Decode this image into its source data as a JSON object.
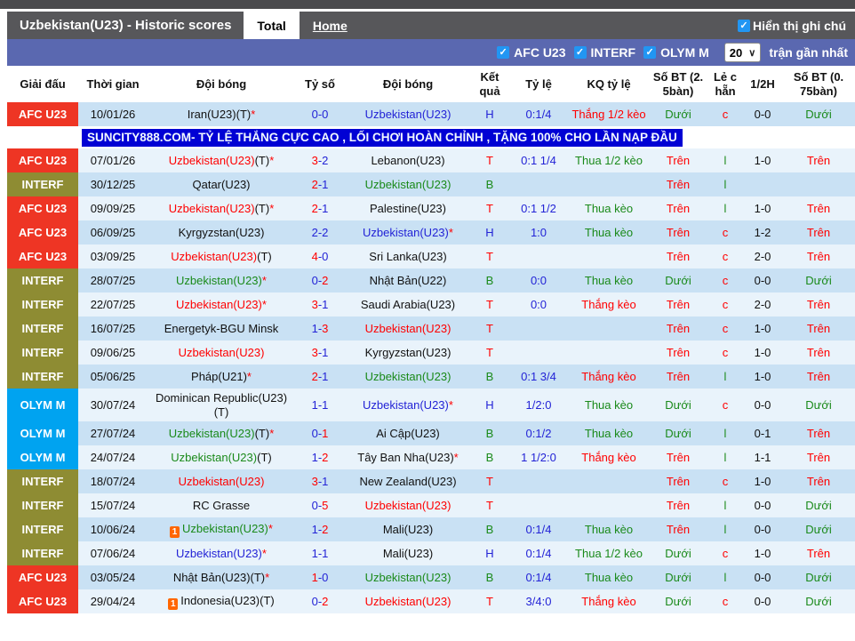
{
  "header": {
    "title": "Uzbekistan(U23) - Historic scores",
    "tabs": [
      {
        "label": "Total",
        "active": true
      },
      {
        "label": "Home",
        "active": false
      }
    ],
    "note_checkbox": {
      "label": "Hiển thị ghi chú",
      "checked": true
    }
  },
  "filterbar": {
    "filters": [
      {
        "label": "AFC U23",
        "checked": true
      },
      {
        "label": "INTERF",
        "checked": true
      },
      {
        "label": "OLYM M",
        "checked": true
      }
    ],
    "select_value": "20",
    "suffix": "trận gần nhất"
  },
  "colors": {
    "afc_badge": "#ee3524",
    "interf_badge": "#8e8c33",
    "olym_badge": "#00a3f0",
    "banner_bg": "#0101d4",
    "filter_bar": "#5a68b0",
    "title_bar": "#57575a",
    "row_odd": "#c9e1f4",
    "row_even": "#e9f3fb",
    "win_red": "#f00",
    "lose_green": "#1a8a1a",
    "draw_blue": "#2323d6"
  },
  "table": {
    "columns": [
      {
        "id": "league",
        "label": "Giải đấu"
      },
      {
        "id": "date",
        "label": "Thời gian"
      },
      {
        "id": "home",
        "label": "Đội bóng"
      },
      {
        "id": "score",
        "label": "Tỷ số"
      },
      {
        "id": "away",
        "label": "Đội bóng"
      },
      {
        "id": "result",
        "label": "Kết\nquả"
      },
      {
        "id": "odds",
        "label": "Tỷ lệ"
      },
      {
        "id": "odds_result",
        "label": "KQ tỷ lệ"
      },
      {
        "id": "goals25",
        "label": "Số BT (2.\n5bàn)"
      },
      {
        "id": "odd_even",
        "label": "Lẻ c\nhẵn"
      },
      {
        "id": "halftime",
        "label": "1/2H"
      },
      {
        "id": "goals075",
        "label": "Số BT (0.\n75bàn)"
      }
    ],
    "rows": [
      {
        "type": "match",
        "league": "AFC U23",
        "lt": "afc",
        "date": "10/01/26",
        "home": [
          {
            "t": "Iran(U23)(T)",
            "c": "black"
          },
          {
            "t": "*",
            "c": "red"
          }
        ],
        "sh": "0",
        "sa": "0",
        "shc": "blue",
        "sac": "blue",
        "away": [
          {
            "t": "Uzbekistan(U23)",
            "c": "blue"
          }
        ],
        "res": {
          "t": "H",
          "c": "blue"
        },
        "odds": "0:1/4",
        "kq": {
          "t": "Thắng 1/2 kèo",
          "c": "red"
        },
        "g25": {
          "t": "Dưới",
          "c": "green"
        },
        "oe": {
          "t": "c",
          "c": "red"
        },
        "ht": "0-0",
        "g075": {
          "t": "Dưới",
          "c": "green"
        }
      },
      {
        "type": "banner",
        "text": "SUNCITY888.COM- TỶ LỆ THẮNG CỰC CAO , LỐI CHƠI HOÀN CHỈNH , TẶNG 100% CHO LẦN NẠP ĐẦU"
      },
      {
        "type": "match",
        "league": "AFC U23",
        "lt": "afc",
        "date": "07/01/26",
        "home": [
          {
            "t": "Uzbekistan(U23)",
            "c": "red"
          },
          {
            "t": "(T)",
            "c": "black"
          },
          {
            "t": "*",
            "c": "red"
          }
        ],
        "sh": "3",
        "sa": "2",
        "shc": "red",
        "sac": "blue",
        "away": [
          {
            "t": "Lebanon(U23)",
            "c": "black"
          }
        ],
        "res": {
          "t": "T",
          "c": "red"
        },
        "odds": "0:1 1/4",
        "kq": {
          "t": "Thua 1/2 kèo",
          "c": "green"
        },
        "g25": {
          "t": "Trên",
          "c": "red"
        },
        "oe": {
          "t": "l",
          "c": "green"
        },
        "ht": "1-0",
        "g075": {
          "t": "Trên",
          "c": "red"
        }
      },
      {
        "type": "match",
        "league": "INTERF",
        "lt": "interf",
        "date": "30/12/25",
        "home": [
          {
            "t": "Qatar(U23)",
            "c": "black"
          }
        ],
        "sh": "2",
        "sa": "1",
        "shc": "red",
        "sac": "blue",
        "away": [
          {
            "t": "Uzbekistan(U23)",
            "c": "green"
          }
        ],
        "res": {
          "t": "B",
          "c": "green"
        },
        "odds": "",
        "kq": null,
        "g25": {
          "t": "Trên",
          "c": "red"
        },
        "oe": {
          "t": "l",
          "c": "green"
        },
        "ht": "",
        "g075": null
      },
      {
        "type": "match",
        "league": "AFC U23",
        "lt": "afc",
        "date": "09/09/25",
        "home": [
          {
            "t": "Uzbekistan(U23)",
            "c": "red"
          },
          {
            "t": "(T)",
            "c": "black"
          },
          {
            "t": "*",
            "c": "red"
          }
        ],
        "sh": "2",
        "sa": "1",
        "shc": "red",
        "sac": "blue",
        "away": [
          {
            "t": "Palestine(U23)",
            "c": "black"
          }
        ],
        "res": {
          "t": "T",
          "c": "red"
        },
        "odds": "0:1 1/2",
        "kq": {
          "t": "Thua kèo",
          "c": "green"
        },
        "g25": {
          "t": "Trên",
          "c": "red"
        },
        "oe": {
          "t": "l",
          "c": "green"
        },
        "ht": "1-0",
        "g075": {
          "t": "Trên",
          "c": "red"
        }
      },
      {
        "type": "match",
        "league": "AFC U23",
        "lt": "afc",
        "date": "06/09/25",
        "home": [
          {
            "t": "Kyrgyzstan(U23)",
            "c": "black"
          }
        ],
        "sh": "2",
        "sa": "2",
        "shc": "blue",
        "sac": "blue",
        "away": [
          {
            "t": "Uzbekistan(U23)",
            "c": "blue"
          },
          {
            "t": "*",
            "c": "red"
          }
        ],
        "res": {
          "t": "H",
          "c": "blue"
        },
        "odds": "1:0",
        "kq": {
          "t": "Thua kèo",
          "c": "green"
        },
        "g25": {
          "t": "Trên",
          "c": "red"
        },
        "oe": {
          "t": "c",
          "c": "red"
        },
        "ht": "1-2",
        "g075": {
          "t": "Trên",
          "c": "red"
        }
      },
      {
        "type": "match",
        "league": "AFC U23",
        "lt": "afc",
        "date": "03/09/25",
        "home": [
          {
            "t": "Uzbekistan(U23)",
            "c": "red"
          },
          {
            "t": "(T)",
            "c": "black"
          }
        ],
        "sh": "4",
        "sa": "0",
        "shc": "red",
        "sac": "blue",
        "away": [
          {
            "t": "Sri Lanka(U23)",
            "c": "black"
          }
        ],
        "res": {
          "t": "T",
          "c": "red"
        },
        "odds": "",
        "kq": null,
        "g25": {
          "t": "Trên",
          "c": "red"
        },
        "oe": {
          "t": "c",
          "c": "red"
        },
        "ht": "2-0",
        "g075": {
          "t": "Trên",
          "c": "red"
        }
      },
      {
        "type": "match",
        "league": "INTERF",
        "lt": "interf",
        "date": "28/07/25",
        "home": [
          {
            "t": "Uzbekistan(U23)",
            "c": "green"
          },
          {
            "t": "*",
            "c": "red"
          }
        ],
        "sh": "0",
        "sa": "2",
        "shc": "blue",
        "sac": "red",
        "away": [
          {
            "t": "Nhật Bản(U22)",
            "c": "black"
          }
        ],
        "res": {
          "t": "B",
          "c": "green"
        },
        "odds": "0:0",
        "kq": {
          "t": "Thua kèo",
          "c": "green"
        },
        "g25": {
          "t": "Dưới",
          "c": "green"
        },
        "oe": {
          "t": "c",
          "c": "red"
        },
        "ht": "0-0",
        "g075": {
          "t": "Dưới",
          "c": "green"
        }
      },
      {
        "type": "match",
        "league": "INTERF",
        "lt": "interf",
        "date": "22/07/25",
        "home": [
          {
            "t": "Uzbekistan(U23)",
            "c": "red"
          },
          {
            "t": "*",
            "c": "red"
          }
        ],
        "sh": "3",
        "sa": "1",
        "shc": "red",
        "sac": "blue",
        "away": [
          {
            "t": "Saudi Arabia(U23)",
            "c": "black"
          }
        ],
        "res": {
          "t": "T",
          "c": "red"
        },
        "odds": "0:0",
        "kq": {
          "t": "Thắng kèo",
          "c": "red"
        },
        "g25": {
          "t": "Trên",
          "c": "red"
        },
        "oe": {
          "t": "c",
          "c": "red"
        },
        "ht": "2-0",
        "g075": {
          "t": "Trên",
          "c": "red"
        }
      },
      {
        "type": "match",
        "league": "INTERF",
        "lt": "interf",
        "date": "16/07/25",
        "home": [
          {
            "t": "Energetyk-BGU Minsk",
            "c": "black"
          }
        ],
        "sh": "1",
        "sa": "3",
        "shc": "blue",
        "sac": "red",
        "away": [
          {
            "t": "Uzbekistan(U23)",
            "c": "red"
          }
        ],
        "res": {
          "t": "T",
          "c": "red"
        },
        "odds": "",
        "kq": null,
        "g25": {
          "t": "Trên",
          "c": "red"
        },
        "oe": {
          "t": "c",
          "c": "red"
        },
        "ht": "1-0",
        "g075": {
          "t": "Trên",
          "c": "red"
        }
      },
      {
        "type": "match",
        "league": "INTERF",
        "lt": "interf",
        "date": "09/06/25",
        "home": [
          {
            "t": "Uzbekistan(U23)",
            "c": "red"
          }
        ],
        "sh": "3",
        "sa": "1",
        "shc": "red",
        "sac": "blue",
        "away": [
          {
            "t": "Kyrgyzstan(U23)",
            "c": "black"
          }
        ],
        "res": {
          "t": "T",
          "c": "red"
        },
        "odds": "",
        "kq": null,
        "g25": {
          "t": "Trên",
          "c": "red"
        },
        "oe": {
          "t": "c",
          "c": "red"
        },
        "ht": "1-0",
        "g075": {
          "t": "Trên",
          "c": "red"
        }
      },
      {
        "type": "match",
        "league": "INTERF",
        "lt": "interf",
        "date": "05/06/25",
        "home": [
          {
            "t": "Pháp(U21)",
            "c": "black"
          },
          {
            "t": "*",
            "c": "red"
          }
        ],
        "sh": "2",
        "sa": "1",
        "shc": "red",
        "sac": "blue",
        "away": [
          {
            "t": "Uzbekistan(U23)",
            "c": "green"
          }
        ],
        "res": {
          "t": "B",
          "c": "green"
        },
        "odds": "0:1 3/4",
        "kq": {
          "t": "Thắng kèo",
          "c": "red"
        },
        "g25": {
          "t": "Trên",
          "c": "red"
        },
        "oe": {
          "t": "l",
          "c": "green"
        },
        "ht": "1-0",
        "g075": {
          "t": "Trên",
          "c": "red"
        }
      },
      {
        "type": "match",
        "league": "OLYM M",
        "lt": "olym",
        "date": "30/07/24",
        "home": [
          {
            "t": "Dominican Republic(U23)(T)",
            "c": "black"
          }
        ],
        "sh": "1",
        "sa": "1",
        "shc": "blue",
        "sac": "blue",
        "away": [
          {
            "t": "Uzbekistan(U23)",
            "c": "blue"
          },
          {
            "t": "*",
            "c": "red"
          }
        ],
        "res": {
          "t": "H",
          "c": "blue"
        },
        "odds": "1/2:0",
        "kq": {
          "t": "Thua kèo",
          "c": "green"
        },
        "g25": {
          "t": "Dưới",
          "c": "green"
        },
        "oe": {
          "t": "c",
          "c": "red"
        },
        "ht": "0-0",
        "g075": {
          "t": "Dưới",
          "c": "green"
        }
      },
      {
        "type": "match",
        "league": "OLYM M",
        "lt": "olym",
        "date": "27/07/24",
        "home": [
          {
            "t": "Uzbekistan(U23)",
            "c": "green"
          },
          {
            "t": "(T)",
            "c": "black"
          },
          {
            "t": "*",
            "c": "red"
          }
        ],
        "sh": "0",
        "sa": "1",
        "shc": "blue",
        "sac": "red",
        "away": [
          {
            "t": "Ai Cập(U23)",
            "c": "black"
          }
        ],
        "res": {
          "t": "B",
          "c": "green"
        },
        "odds": "0:1/2",
        "kq": {
          "t": "Thua kèo",
          "c": "green"
        },
        "g25": {
          "t": "Dưới",
          "c": "green"
        },
        "oe": {
          "t": "l",
          "c": "green"
        },
        "ht": "0-1",
        "g075": {
          "t": "Trên",
          "c": "red"
        }
      },
      {
        "type": "match",
        "league": "OLYM M",
        "lt": "olym",
        "date": "24/07/24",
        "home": [
          {
            "t": "Uzbekistan(U23)",
            "c": "green"
          },
          {
            "t": "(T)",
            "c": "black"
          }
        ],
        "sh": "1",
        "sa": "2",
        "shc": "blue",
        "sac": "red",
        "away": [
          {
            "t": "Tây Ban Nha(U23)",
            "c": "black"
          },
          {
            "t": "*",
            "c": "red"
          }
        ],
        "res": {
          "t": "B",
          "c": "green"
        },
        "odds": "1 1/2:0",
        "kq": {
          "t": "Thắng kèo",
          "c": "red"
        },
        "g25": {
          "t": "Trên",
          "c": "red"
        },
        "oe": {
          "t": "l",
          "c": "green"
        },
        "ht": "1-1",
        "g075": {
          "t": "Trên",
          "c": "red"
        }
      },
      {
        "type": "match",
        "league": "INTERF",
        "lt": "interf",
        "date": "18/07/24",
        "home": [
          {
            "t": "Uzbekistan(U23)",
            "c": "red"
          }
        ],
        "sh": "3",
        "sa": "1",
        "shc": "red",
        "sac": "blue",
        "away": [
          {
            "t": "New Zealand(U23)",
            "c": "black"
          }
        ],
        "res": {
          "t": "T",
          "c": "red"
        },
        "odds": "",
        "kq": null,
        "g25": {
          "t": "Trên",
          "c": "red"
        },
        "oe": {
          "t": "c",
          "c": "red"
        },
        "ht": "1-0",
        "g075": {
          "t": "Trên",
          "c": "red"
        }
      },
      {
        "type": "match",
        "league": "INTERF",
        "lt": "interf",
        "date": "15/07/24",
        "home": [
          {
            "t": "RC Grasse",
            "c": "black"
          }
        ],
        "sh": "0",
        "sa": "5",
        "shc": "blue",
        "sac": "red",
        "away": [
          {
            "t": "Uzbekistan(U23)",
            "c": "red"
          }
        ],
        "res": {
          "t": "T",
          "c": "red"
        },
        "odds": "",
        "kq": null,
        "g25": {
          "t": "Trên",
          "c": "red"
        },
        "oe": {
          "t": "l",
          "c": "green"
        },
        "ht": "0-0",
        "g075": {
          "t": "Dưới",
          "c": "green"
        }
      },
      {
        "type": "match",
        "league": "INTERF",
        "lt": "interf",
        "date": "10/06/24",
        "home": [
          {
            "icon": "red-card"
          },
          {
            "t": "Uzbekistan(U23)",
            "c": "green"
          },
          {
            "t": "*",
            "c": "red"
          }
        ],
        "sh": "1",
        "sa": "2",
        "shc": "blue",
        "sac": "red",
        "away": [
          {
            "t": "Mali(U23)",
            "c": "black"
          }
        ],
        "res": {
          "t": "B",
          "c": "green"
        },
        "odds": "0:1/4",
        "kq": {
          "t": "Thua kèo",
          "c": "green"
        },
        "g25": {
          "t": "Trên",
          "c": "red"
        },
        "oe": {
          "t": "l",
          "c": "green"
        },
        "ht": "0-0",
        "g075": {
          "t": "Dưới",
          "c": "green"
        }
      },
      {
        "type": "match",
        "league": "INTERF",
        "lt": "interf",
        "date": "07/06/24",
        "home": [
          {
            "t": "Uzbekistan(U23)",
            "c": "blue"
          },
          {
            "t": "*",
            "c": "red"
          }
        ],
        "sh": "1",
        "sa": "1",
        "shc": "blue",
        "sac": "blue",
        "away": [
          {
            "t": "Mali(U23)",
            "c": "black"
          }
        ],
        "res": {
          "t": "H",
          "c": "blue"
        },
        "odds": "0:1/4",
        "kq": {
          "t": "Thua 1/2 kèo",
          "c": "green"
        },
        "g25": {
          "t": "Dưới",
          "c": "green"
        },
        "oe": {
          "t": "c",
          "c": "red"
        },
        "ht": "1-0",
        "g075": {
          "t": "Trên",
          "c": "red"
        }
      },
      {
        "type": "match",
        "league": "AFC U23",
        "lt": "afc",
        "date": "03/05/24",
        "home": [
          {
            "t": "Nhật Bản(U23)(T)",
            "c": "black"
          },
          {
            "t": "*",
            "c": "red"
          }
        ],
        "sh": "1",
        "sa": "0",
        "shc": "red",
        "sac": "blue",
        "away": [
          {
            "t": "Uzbekistan(U23)",
            "c": "green"
          }
        ],
        "res": {
          "t": "B",
          "c": "green"
        },
        "odds": "0:1/4",
        "kq": {
          "t": "Thua kèo",
          "c": "green"
        },
        "g25": {
          "t": "Dưới",
          "c": "green"
        },
        "oe": {
          "t": "l",
          "c": "green"
        },
        "ht": "0-0",
        "g075": {
          "t": "Dưới",
          "c": "green"
        }
      },
      {
        "type": "match",
        "league": "AFC U23",
        "lt": "afc",
        "date": "29/04/24",
        "home": [
          {
            "icon": "red-card"
          },
          {
            "t": "Indonesia(U23)(T)",
            "c": "black"
          }
        ],
        "sh": "0",
        "sa": "2",
        "shc": "blue",
        "sac": "red",
        "away": [
          {
            "t": "Uzbekistan(U23)",
            "c": "red"
          }
        ],
        "res": {
          "t": "T",
          "c": "red"
        },
        "odds": "3/4:0",
        "kq": {
          "t": "Thắng kèo",
          "c": "red"
        },
        "g25": {
          "t": "Dưới",
          "c": "green"
        },
        "oe": {
          "t": "c",
          "c": "red"
        },
        "ht": "0-0",
        "g075": {
          "t": "Dưới",
          "c": "green"
        }
      }
    ]
  }
}
